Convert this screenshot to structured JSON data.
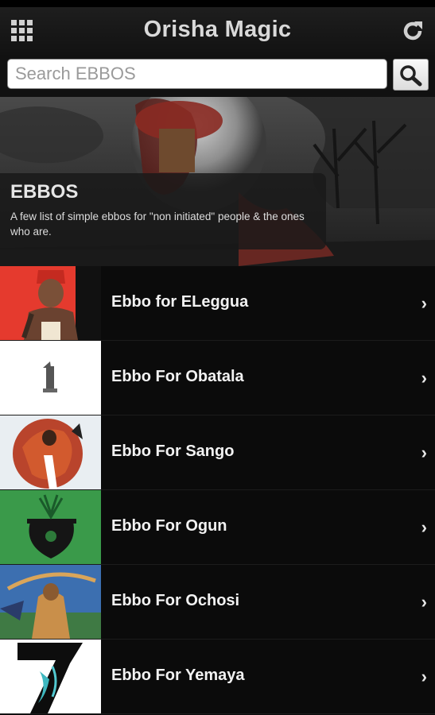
{
  "header": {
    "title": "Orisha Magic",
    "menu_icon": "grid-menu-icon",
    "refresh_icon": "refresh-icon"
  },
  "search": {
    "placeholder": "Search EBBOS",
    "value": "",
    "button_icon": "search-icon"
  },
  "hero": {
    "title": "EBBOS",
    "description": "A few list of simple ebbos for \"non initiated\" people & the ones who are."
  },
  "list": {
    "items": [
      {
        "label": "Ebbo for ELeggua",
        "thumb_bg": "#e53a2e"
      },
      {
        "label": "Ebbo For Obatala",
        "thumb_bg": "#ffffff"
      },
      {
        "label": "Ebbo For Sango",
        "thumb_bg": "#e9eef2"
      },
      {
        "label": "Ebbo For Ogun",
        "thumb_bg": "#3a9a4a"
      },
      {
        "label": "Ebbo For Ochosi",
        "thumb_bg": "#3c6fb0"
      },
      {
        "label": "Ebbo For Yemaya",
        "thumb_bg": "#ffffff"
      }
    ],
    "chevron_icon": "chevron-right-icon"
  },
  "colors": {
    "background": "#0b0b0b",
    "header": "#1a1a1a",
    "text": "#f2f2f2"
  }
}
